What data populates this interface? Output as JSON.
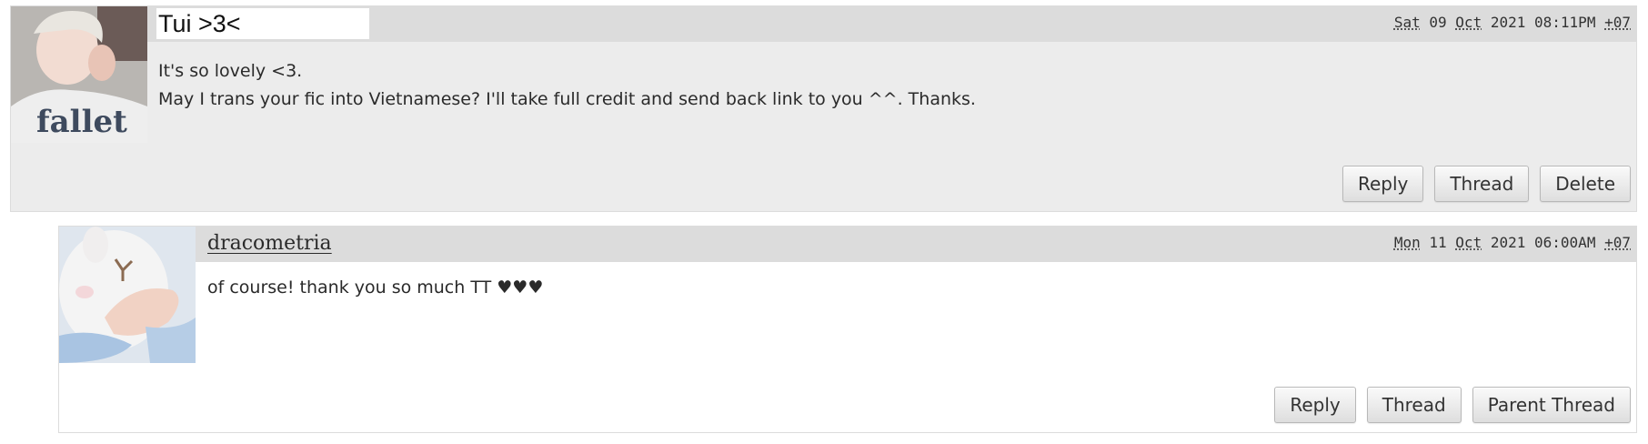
{
  "comments": [
    {
      "username": "Tui >3<",
      "timestamp": {
        "day": "Sat",
        "date": "09",
        "month": "Oct",
        "year": "2021",
        "time": "08:11PM",
        "tz": "+07"
      },
      "lines": [
        "It's so lovely <3.",
        "May I trans your fic into Vietnamese? I'll take full credit and send back link to you ^^. Thanks."
      ],
      "avatar_text": "fallet",
      "actions": [
        "Reply",
        "Thread",
        "Delete"
      ]
    },
    {
      "username": "dracometria",
      "timestamp": {
        "day": "Mon",
        "date": "11",
        "month": "Oct",
        "year": "2021",
        "time": "06:00AM",
        "tz": "+07"
      },
      "lines": [
        "of course! thank you so much TT ♥♥♥"
      ],
      "actions": [
        "Reply",
        "Thread",
        "Parent Thread"
      ]
    }
  ],
  "colors": {
    "comment_bg": "#ececec",
    "header_bar": "#dcdcdc",
    "reply_bg": "#ffffff",
    "border": "#dcdcdc"
  }
}
